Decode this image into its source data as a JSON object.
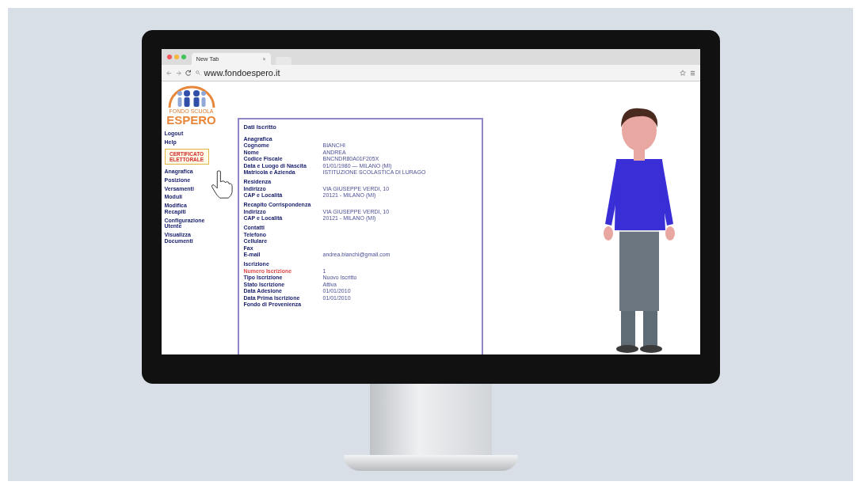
{
  "browser": {
    "tab_title": "New Tab",
    "tab_close": "×",
    "url": "www.fondoespero.it"
  },
  "logo": {
    "line1": "FONDO SCUOLA",
    "line2": "ESPERO"
  },
  "sidebar": {
    "items": [
      {
        "label": "Logout",
        "kind": "link"
      },
      {
        "label": "Help",
        "kind": "link"
      },
      {
        "label": "CERTIFICATO ELETTORALE",
        "kind": "button"
      },
      {
        "label": "Anagrafica",
        "kind": "link"
      },
      {
        "label": "Posizione",
        "kind": "link"
      },
      {
        "label": "Versamenti",
        "kind": "link"
      },
      {
        "label": "Moduli",
        "kind": "link"
      },
      {
        "label": "Modifica Recapiti",
        "kind": "link"
      },
      {
        "label": "Configurazione Utente",
        "kind": "link"
      },
      {
        "label": "Visualizza Documenti",
        "kind": "link"
      }
    ]
  },
  "card": {
    "title": "Dati Iscritto",
    "sections": [
      {
        "heading": "Anagrafica",
        "rows": [
          {
            "label": "Cognome",
            "value": "BIANCHI",
            "alert": false
          },
          {
            "label": "Nome",
            "value": "ANDREA",
            "alert": false
          },
          {
            "label": "Codice Fiscale",
            "value": "BNCNDR80A01F205X",
            "alert": false
          },
          {
            "label": "Data e Luogo di Nascita",
            "value": "01/01/1980 — MILANO (MI)",
            "alert": false
          },
          {
            "label": "Matricola e Azienda",
            "value": "ISTITUZIONE SCOLASTICA DI LURAGO",
            "alert": false
          }
        ]
      },
      {
        "heading": "Residenza",
        "rows": [
          {
            "label": "Indirizzo",
            "value": "VIA GIUSEPPE VERDI, 10",
            "alert": false
          },
          {
            "label": "CAP e Località",
            "value": "20121 - MILANO (MI)",
            "alert": false
          }
        ]
      },
      {
        "heading": "Recapito Corrispondenza",
        "rows": [
          {
            "label": "Indirizzo",
            "value": "VIA GIUSEPPE VERDI, 10",
            "alert": false
          },
          {
            "label": "CAP e Località",
            "value": "20121 - MILANO (MI)",
            "alert": false
          }
        ]
      },
      {
        "heading": "Contatti",
        "rows": [
          {
            "label": "Telefono",
            "alert": false
          },
          {
            "label": "Cellulare",
            "alert": false
          },
          {
            "label": "Fax",
            "alert": false
          },
          {
            "label": "E-mail",
            "value": "andrea.bianchi@gmail.com",
            "alert": false
          }
        ]
      },
      {
        "heading": "Iscrizione",
        "rows": [
          {
            "label": "Numero Iscrizione",
            "value": "1",
            "alert": true
          },
          {
            "label": "Tipo Iscrizione",
            "value": "Nuovo Iscritto",
            "alert": false
          },
          {
            "label": "Stato Iscrizione",
            "value": "Attiva",
            "alert": false
          },
          {
            "label": "Data Adesione",
            "value": "01/01/2010",
            "alert": false
          },
          {
            "label": "Data Prima Iscrizione",
            "value": "01/01/2010",
            "alert": false
          },
          {
            "label": "Fondo di Provenienza",
            "alert": false
          }
        ]
      }
    ]
  }
}
